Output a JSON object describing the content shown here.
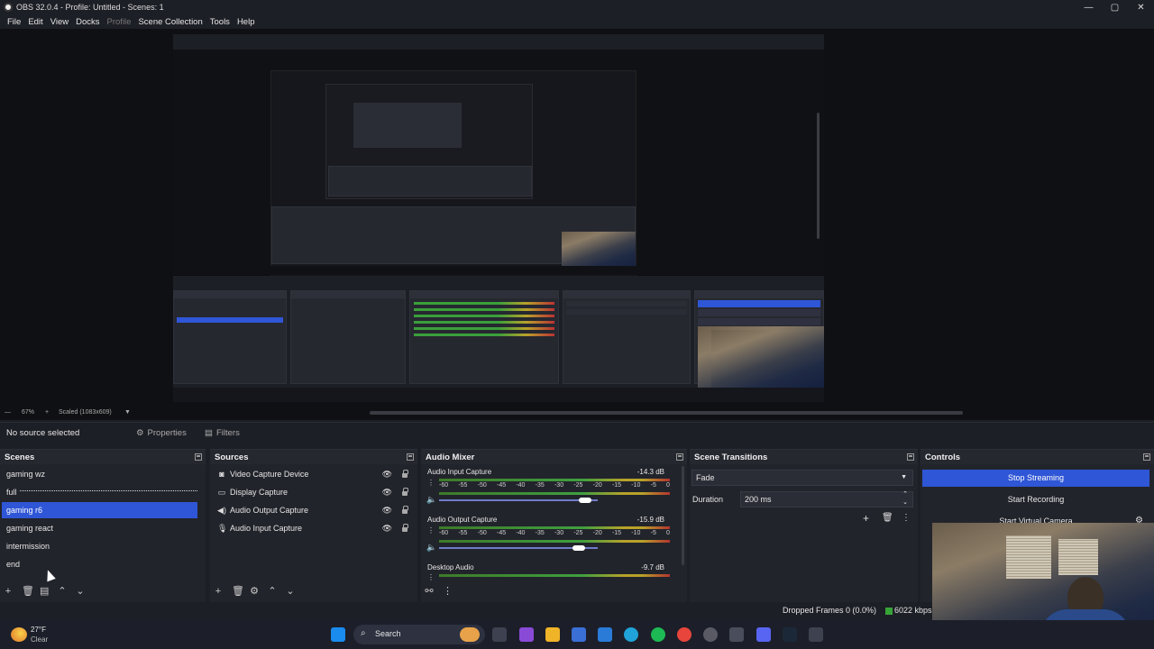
{
  "window": {
    "title": "OBS 32.0.4 - Profile: Untitled - Scenes: 1",
    "controls": [
      "—",
      "▢",
      "✕"
    ]
  },
  "menu": [
    "File",
    "Edit",
    "View",
    "Docks",
    "Profile",
    "Scene Collection",
    "Tools",
    "Help"
  ],
  "preview": {
    "zoom": "67%",
    "scale": "Scaled (1083x609)"
  },
  "properties_bar": {
    "no_source": "No source selected",
    "properties": "Properties",
    "filters": "Filters"
  },
  "scenes": {
    "title": "Scenes",
    "items": [
      "gaming wz",
      "full",
      "gaming r6",
      "gaming react",
      "intermission",
      "end"
    ],
    "selected": "gaming r6"
  },
  "sources": {
    "title": "Sources",
    "items": [
      {
        "name": "Video Capture Device",
        "icon": "camera-icon"
      },
      {
        "name": "Display Capture",
        "icon": "monitor-icon"
      },
      {
        "name": "Audio Output Capture",
        "icon": "speaker-icon"
      },
      {
        "name": "Audio Input Capture",
        "icon": "microphone-icon"
      }
    ]
  },
  "mixer": {
    "title": "Audio Mixer",
    "ticks": [
      "-60",
      "-55",
      "-50",
      "-45",
      "-40",
      "-35",
      "-30",
      "-25",
      "-20",
      "-15",
      "-10",
      "-5",
      "0"
    ],
    "channels": [
      {
        "name": "Audio Input Capture",
        "db": "-14.3 dB",
        "volume": 0.92
      },
      {
        "name": "Audio Output Capture",
        "db": "-15.9 dB",
        "volume": 0.88
      },
      {
        "name": "Desktop Audio",
        "db": "-9.7 dB"
      }
    ]
  },
  "transitions": {
    "title": "Scene Transitions",
    "type": "Fade",
    "duration_label": "Duration",
    "duration_value": "200 ms"
  },
  "controls": {
    "title": "Controls",
    "stop_streaming": "Stop Streaming",
    "start_recording": "Start Recording",
    "start_virtual_camera": "Start Virtual Camera"
  },
  "status": {
    "dropped_frames": "Dropped Frames 0 (0.0%)",
    "bitrate": "6022 kbps"
  },
  "taskbar": {
    "weather_temp": "27°F",
    "weather_text": "Clear",
    "search": "Search"
  },
  "colors": {
    "accent": "#2f56d6",
    "background": "#1d1f26",
    "dock": "#22242b"
  }
}
